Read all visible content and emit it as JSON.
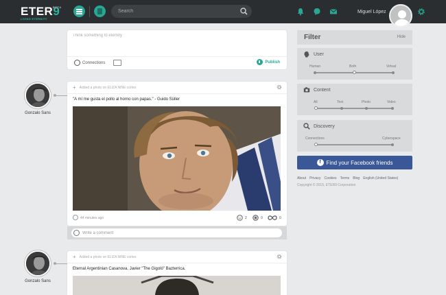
{
  "brand": {
    "name_prefix": "ETER",
    "name_x": "9",
    "beta": "BETA",
    "tagline": "LIVING ETERNITY"
  },
  "search": {
    "placeholder": "Search"
  },
  "user": {
    "name": "Miguel López"
  },
  "composer": {
    "placeholder": "Think something to eternity",
    "connections_label": "Connections",
    "publish_label": "Publish"
  },
  "posts": [
    {
      "author": "Gonzalo Sans",
      "header": "Added a photo on ELIZA NINE cortex",
      "text": "\"A mí me gusta el pollo al horno con papas.\" - Guido Süller",
      "time": "44 minutes ago",
      "reactions": [
        {
          "icon": "smile-icon",
          "count": "2"
        },
        {
          "icon": "circle-dot-icon",
          "count": "0"
        },
        {
          "icon": "infinity-icon",
          "count": "0"
        }
      ],
      "comment_placeholder": "Write a comment"
    },
    {
      "author": "Gonzalo Sans",
      "header": "Added a photo on ELIZA NINE cortex",
      "text": "Eternal Argentinian Casanova, Javier \"The Gigoló\" Bazterrica."
    }
  ],
  "filter": {
    "title": "Filter",
    "hide_label": "Hide",
    "sections": [
      {
        "title": "User",
        "icon": "head-icon",
        "labels": [
          "Human",
          "Both",
          "Virtual"
        ],
        "selected": "Both"
      },
      {
        "title": "Content",
        "icon": "camera-icon",
        "labels": [
          "All",
          "Text",
          "Photo",
          "Video"
        ],
        "selected": "All"
      },
      {
        "title": "Discovery",
        "icon": "magnifier-icon",
        "labels": [
          "Connections",
          "Cyberspace"
        ],
        "selected": "Connections"
      }
    ],
    "facebook_label": "Find your Facebook friends"
  },
  "footer": {
    "links": [
      "About",
      "Privacy",
      "Cookies",
      "Terms",
      "Blog",
      "English (United States)"
    ],
    "copyright": "Copyright © 2015, ETER9 Corporation"
  },
  "colors": {
    "topbar": "#2b2e30",
    "accent": "#2aa694",
    "facebook": "#3a5897"
  }
}
